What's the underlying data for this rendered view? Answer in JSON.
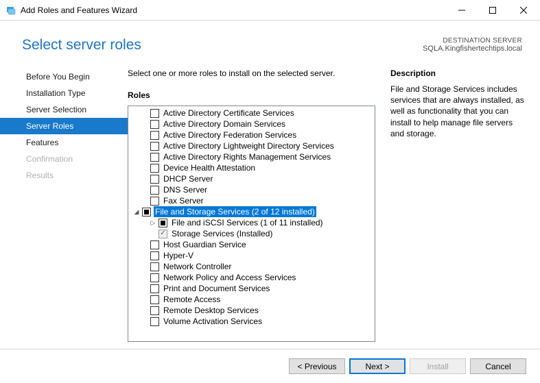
{
  "window": {
    "title": "Add Roles and Features Wizard"
  },
  "header": {
    "title": "Select server roles",
    "dest_label": "DESTINATION SERVER",
    "dest_value": "SQLA.Kingfishertechtips.local"
  },
  "sidebar": {
    "items": [
      {
        "label": "Before You Begin",
        "state": "normal"
      },
      {
        "label": "Installation Type",
        "state": "normal"
      },
      {
        "label": "Server Selection",
        "state": "normal"
      },
      {
        "label": "Server Roles",
        "state": "selected"
      },
      {
        "label": "Features",
        "state": "normal"
      },
      {
        "label": "Confirmation",
        "state": "disabled"
      },
      {
        "label": "Results",
        "state": "disabled"
      }
    ]
  },
  "main": {
    "instruction": "Select one or more roles to install on the selected server.",
    "roles_header": "Roles",
    "desc_header": "Description",
    "description": "File and Storage Services includes services that are always installed, as well as functionality that you can install to help manage file servers and storage."
  },
  "roles": [
    {
      "label": "Active Directory Certificate Services",
      "depth": 0,
      "check": "none"
    },
    {
      "label": "Active Directory Domain Services",
      "depth": 0,
      "check": "none"
    },
    {
      "label": "Active Directory Federation Services",
      "depth": 0,
      "check": "none"
    },
    {
      "label": "Active Directory Lightweight Directory Services",
      "depth": 0,
      "check": "none"
    },
    {
      "label": "Active Directory Rights Management Services",
      "depth": 0,
      "check": "none"
    },
    {
      "label": "Device Health Attestation",
      "depth": 0,
      "check": "none"
    },
    {
      "label": "DHCP Server",
      "depth": 0,
      "check": "none"
    },
    {
      "label": "DNS Server",
      "depth": 0,
      "check": "none"
    },
    {
      "label": "Fax Server",
      "depth": 0,
      "check": "none"
    },
    {
      "label": "File and Storage Services (2 of 12 installed)",
      "depth": 0,
      "check": "partial",
      "expander": "expanded",
      "selected": true
    },
    {
      "label": "File and iSCSI Services (1 of 11 installed)",
      "depth": 1,
      "check": "partial",
      "expander": "collapsed"
    },
    {
      "label": "Storage Services (Installed)",
      "depth": 1,
      "check": "checked-disabled"
    },
    {
      "label": "Host Guardian Service",
      "depth": 0,
      "check": "none"
    },
    {
      "label": "Hyper-V",
      "depth": 0,
      "check": "none"
    },
    {
      "label": "Network Controller",
      "depth": 0,
      "check": "none"
    },
    {
      "label": "Network Policy and Access Services",
      "depth": 0,
      "check": "none"
    },
    {
      "label": "Print and Document Services",
      "depth": 0,
      "check": "none"
    },
    {
      "label": "Remote Access",
      "depth": 0,
      "check": "none"
    },
    {
      "label": "Remote Desktop Services",
      "depth": 0,
      "check": "none"
    },
    {
      "label": "Volume Activation Services",
      "depth": 0,
      "check": "none"
    }
  ],
  "footer": {
    "previous": "< Previous",
    "next": "Next >",
    "install": "Install",
    "cancel": "Cancel"
  }
}
